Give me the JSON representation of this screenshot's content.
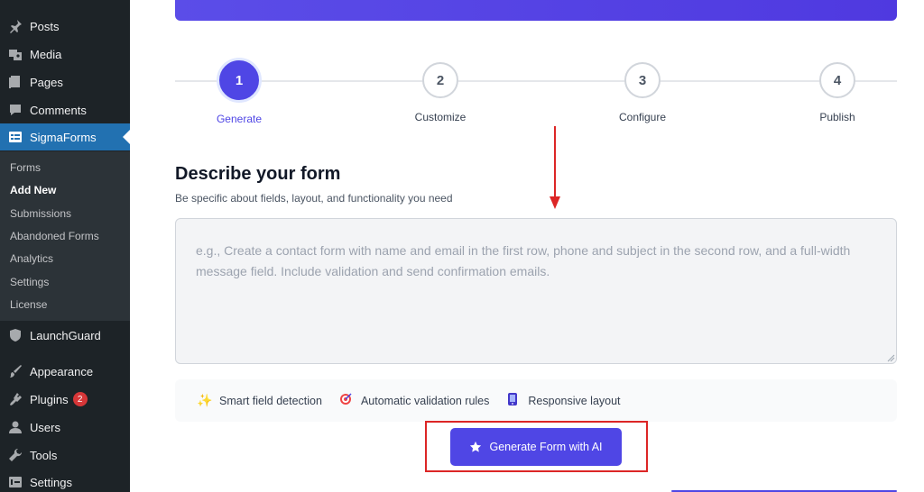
{
  "sidebar": {
    "items": [
      {
        "label": "Posts",
        "icon": "pin-icon"
      },
      {
        "label": "Media",
        "icon": "media-icon"
      },
      {
        "label": "Pages",
        "icon": "pages-icon"
      },
      {
        "label": "Comments",
        "icon": "comment-icon"
      },
      {
        "label": "SigmaForms",
        "icon": "form-icon"
      },
      {
        "label": "LaunchGuard",
        "icon": "shield-icon"
      },
      {
        "label": "Appearance",
        "icon": "brush-icon"
      },
      {
        "label": "Plugins",
        "icon": "plugin-icon",
        "badge": "2"
      },
      {
        "label": "Users",
        "icon": "user-icon"
      },
      {
        "label": "Tools",
        "icon": "wrench-icon"
      },
      {
        "label": "Settings",
        "icon": "settings-icon"
      }
    ],
    "submenu": [
      "Forms",
      "Add New",
      "Submissions",
      "Abandoned Forms",
      "Analytics",
      "Settings",
      "License"
    ],
    "active_color": "#2271b1"
  },
  "stepper": {
    "steps": [
      {
        "number": "1",
        "label": "Generate"
      },
      {
        "number": "2",
        "label": "Customize"
      },
      {
        "number": "3",
        "label": "Configure"
      },
      {
        "number": "4",
        "label": "Publish"
      }
    ],
    "active_color": "#4f46e5"
  },
  "form": {
    "title": "Describe your form",
    "subtitle": "Be specific about fields, layout, and functionality you need",
    "placeholder": "e.g., Create a contact form with name and email in the first row, phone and subject in the second row, and a full-width message field. Include validation and send confirmation emails."
  },
  "features": [
    {
      "label": "Smart field detection",
      "icon": "sparkle-icon"
    },
    {
      "label": "Automatic validation rules",
      "icon": "target-icon"
    },
    {
      "label": "Responsive layout",
      "icon": "phone-icon"
    }
  ],
  "generate_button": {
    "label": "Generate Form with AI",
    "icon": "star-icon"
  },
  "annotation_color": "#dc2626"
}
